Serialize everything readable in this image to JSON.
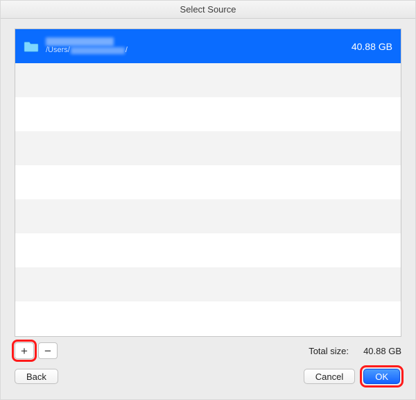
{
  "window": {
    "title": "Select Source"
  },
  "list": {
    "items": [
      {
        "name": "",
        "path_prefix": "/Users/",
        "path_suffix": "/",
        "size": "40.88 GB",
        "selected": true
      }
    ]
  },
  "controls": {
    "add_label": "+",
    "remove_label": "−",
    "total_label": "Total size:",
    "total_value": "40.88 GB"
  },
  "buttons": {
    "back": "Back",
    "cancel": "Cancel",
    "ok": "OK"
  },
  "colors": {
    "selection": "#0a6cff",
    "highlight": "#ff1a1a"
  }
}
